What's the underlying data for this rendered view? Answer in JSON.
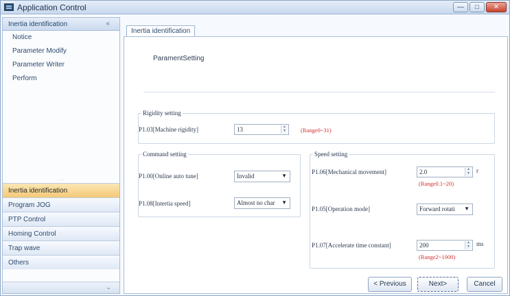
{
  "window": {
    "title": "Application Control",
    "buttons": {
      "minimize": "—",
      "maximize": "□",
      "close": "✕"
    }
  },
  "nav": {
    "header": "Inertia identification",
    "collapse_glyph": "«",
    "sub_items": [
      "Notice",
      "Parameter Modify",
      "Parameter Writer",
      "Perform"
    ],
    "grip": "·····",
    "groups": [
      {
        "label": "Inertia identification",
        "active": true
      },
      {
        "label": "Program JOG",
        "active": false
      },
      {
        "label": "PTP Control",
        "active": false
      },
      {
        "label": "Homing Control",
        "active": false
      },
      {
        "label": "Trap wave",
        "active": false
      },
      {
        "label": "Others",
        "active": false
      }
    ],
    "footer_glyph": "⌄"
  },
  "tab": {
    "label": "Inertia identification"
  },
  "page": {
    "heading": "ParamentSetting",
    "rigidity": {
      "legend": "Rigidity setting",
      "label": "P1.03[Machine rigidity]",
      "value": "13",
      "range": "(Range0~31)"
    },
    "command": {
      "legend": "Command setting",
      "online_label": "P1.00[Online auto tune]",
      "online_value": "Invalid",
      "inertia_label": "P1.08[Intertia speed]",
      "inertia_value": "Almost no char"
    },
    "speed": {
      "legend": "Speed setting",
      "mech_label": "P1.06[Mechanical movement]",
      "mech_value": "2.0",
      "mech_unit": "r",
      "mech_range": "(Range0.1~20)",
      "op_label": "P1.05[Operation mode]",
      "op_value": "Forward rotati",
      "accel_label": "P1.07[Accelerate time constant]",
      "accel_value": "200",
      "accel_unit": "ms",
      "accel_range": "(Range2~1000)"
    }
  },
  "footer": {
    "previous": "< Previous",
    "next": "Next>",
    "cancel": "Cancel"
  },
  "colors": {
    "accent": "#f4c977",
    "border": "#a9bdd8",
    "range_text": "#d42b2b"
  }
}
